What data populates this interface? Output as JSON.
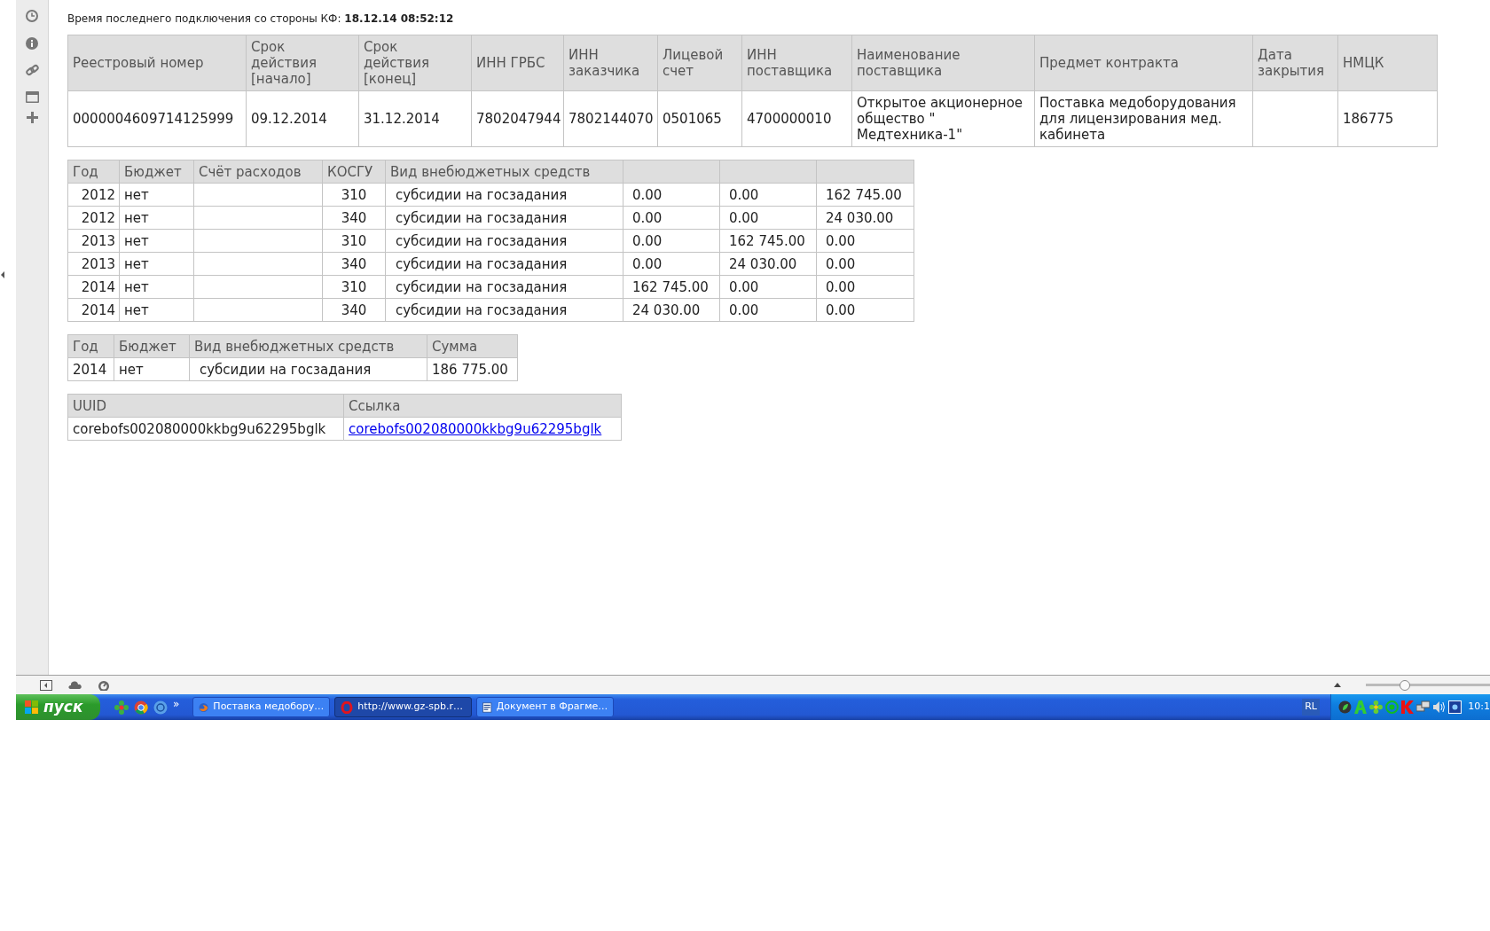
{
  "header": {
    "label": "Время последнего подключения со стороны КФ:",
    "value": "18.12.14 08:52:12"
  },
  "contract_table": {
    "columns": [
      "Реестровый номер",
      "Срок действия [начало]",
      "Срок действия [конец]",
      "ИНН ГРБС",
      "ИНН заказчика",
      "Лицевой счет",
      "ИНН поставщика",
      "Наименование поставщика",
      "Предмет контракта",
      "Дата закрытия",
      "НМЦК"
    ],
    "rows": [
      [
        "0000004609714125999",
        "09.12.2014",
        "31.12.2014",
        "7802047944",
        "7802144070",
        "0501065",
        "4700000010",
        "Открытое акционерное общество \" Медтехника-1\"",
        "Поставка медоборудования для лицензирования мед. кабинета",
        "",
        "186775"
      ]
    ]
  },
  "finance_table": {
    "columns": [
      "Год",
      "Бюджет",
      "Счёт расходов",
      "КОСГУ",
      "Вид внебюджетных средств",
      "",
      "",
      ""
    ],
    "rows": [
      [
        "2012",
        "нет",
        "",
        "310",
        "субсидии на госзадания",
        "0.00",
        "0.00",
        "162 745.00"
      ],
      [
        "2012",
        "нет",
        "",
        "340",
        "субсидии на госзадания",
        "0.00",
        "0.00",
        "24 030.00"
      ],
      [
        "2013",
        "нет",
        "",
        "310",
        "субсидии на госзадания",
        "0.00",
        "162 745.00",
        "0.00"
      ],
      [
        "2013",
        "нет",
        "",
        "340",
        "субсидии на госзадания",
        "0.00",
        "24 030.00",
        "0.00"
      ],
      [
        "2014",
        "нет",
        "",
        "310",
        "субсидии на госзадания",
        "162 745.00",
        "0.00",
        "0.00"
      ],
      [
        "2014",
        "нет",
        "",
        "340",
        "субсидии на госзадания",
        "24 030.00",
        "0.00",
        "0.00"
      ]
    ]
  },
  "sum_table": {
    "columns": [
      "Год",
      "Бюджет",
      "Вид внебюджетных средств",
      "Сумма"
    ],
    "rows": [
      [
        "2014",
        "нет",
        "субсидии на госзадания",
        "186 775.00"
      ]
    ]
  },
  "uuid_table": {
    "columns": [
      "UUID",
      "Ссылка"
    ],
    "rows": [
      {
        "uuid": "corebofs002080000kkbg9u62295bglk",
        "link": "corebofs002080000kkbg9u62295bglk"
      }
    ]
  },
  "status_bar": {
    "zoom_slider": {
      "level": 0.3
    }
  },
  "taskbar": {
    "start": "пуск",
    "quick_launch_more": "»",
    "tasks": [
      {
        "kind": "browser",
        "label": "Поставка медобору…",
        "selected": false
      },
      {
        "kind": "ring",
        "label": "http://www.gz-spb.r…",
        "selected": true
      },
      {
        "kind": "document",
        "label": "Документ в Фрагме…",
        "selected": false
      }
    ],
    "language": "RL",
    "clock": "10:1"
  }
}
